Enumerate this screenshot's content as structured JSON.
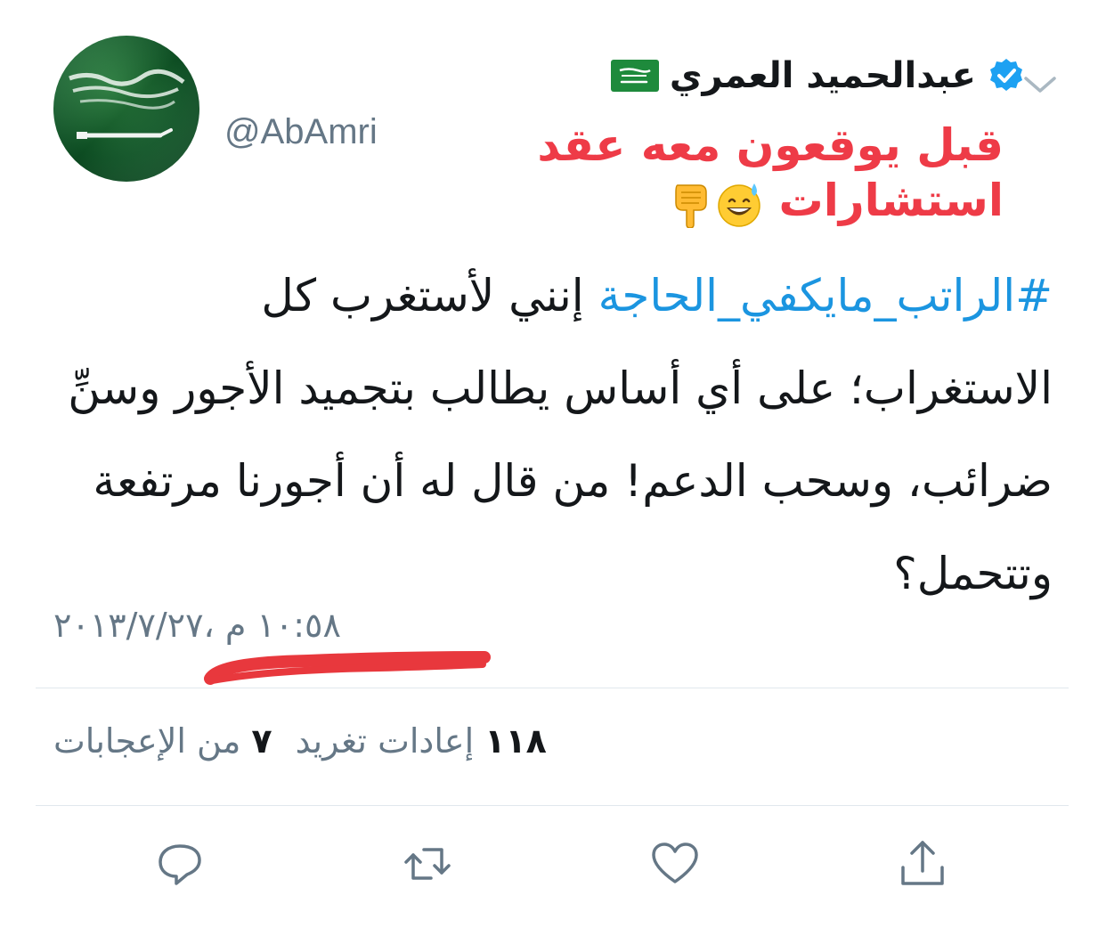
{
  "author": {
    "display_name": "عبدالحميد العمري",
    "handle": "@AbAmri",
    "verified": true,
    "flag": "saudi-flag",
    "avatar": "saudi-flag-avatar"
  },
  "annotation": {
    "text_line1": "قبل يوقعون معه عقد",
    "text_line2": "استشارات",
    "color": "#ee3b47",
    "emojis": [
      "grinning-sweat-face",
      "pointing-down-hand"
    ]
  },
  "tweet": {
    "hashtag": "#الراتب_مايكفي_الحاجة",
    "text": "إنني لأستغرب كل الاستغراب؛ على أي أساس يطالب بتجميد الأجور وسنِّ ضرائب، وسحب الدعم! من قال له أن أجورنا مرتفعة وتتحمل؟",
    "timestamp": "١٠:٥٨ م ،٢٠١٣/٧/٢٧"
  },
  "stats": {
    "retweets_count": "١١٨",
    "retweets_label": "إعادات تغريد",
    "likes_count": "٧",
    "likes_label": "من الإعجابات"
  },
  "actions": [
    "reply-icon",
    "retweet-icon",
    "like-icon",
    "share-icon"
  ],
  "colors": {
    "link": "#1b95e0",
    "text": "#14171a",
    "secondary": "#657786",
    "annotation_red": "#ee3b47",
    "verified_blue": "#1da1f2"
  }
}
